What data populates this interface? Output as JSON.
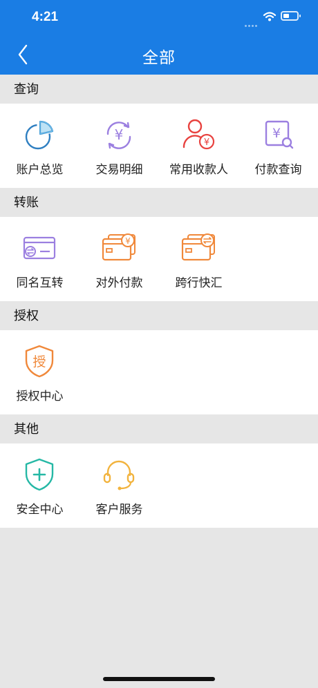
{
  "status_bar": {
    "time": "4:21"
  },
  "nav": {
    "title": "全部"
  },
  "sections": [
    {
      "title": "查询",
      "items": [
        {
          "label": "账户总览",
          "icon": "pie-chart-icon"
        },
        {
          "label": "交易明细",
          "icon": "yen-cycle-icon"
        },
        {
          "label": "常用收款人",
          "icon": "payee-icon"
        },
        {
          "label": "付款查询",
          "icon": "yen-search-icon"
        }
      ]
    },
    {
      "title": "转账",
      "items": [
        {
          "label": "同名互转",
          "icon": "card-exchange-icon"
        },
        {
          "label": "对外付款",
          "icon": "card-yen-icon"
        },
        {
          "label": "跨行快汇",
          "icon": "card-transfer-icon"
        }
      ]
    },
    {
      "title": "授权",
      "items": [
        {
          "label": "授权中心",
          "icon": "authorize-shield-icon",
          "glyph": "授"
        }
      ]
    },
    {
      "title": "其他",
      "items": [
        {
          "label": "安全中心",
          "icon": "shield-plus-icon"
        },
        {
          "label": "客户服务",
          "icon": "headset-icon"
        }
      ]
    }
  ],
  "icon_symbols": {
    "yen": "¥"
  },
  "colors": {
    "header_blue": "#1a7de4",
    "page_gray": "#e6e6e6",
    "icon_blue": "#2f7fc1",
    "icon_purple": "#9b7fe0",
    "icon_red": "#e8423f",
    "icon_orange": "#f0883a",
    "icon_teal": "#25b8a5",
    "icon_yellow": "#f2b33d"
  }
}
